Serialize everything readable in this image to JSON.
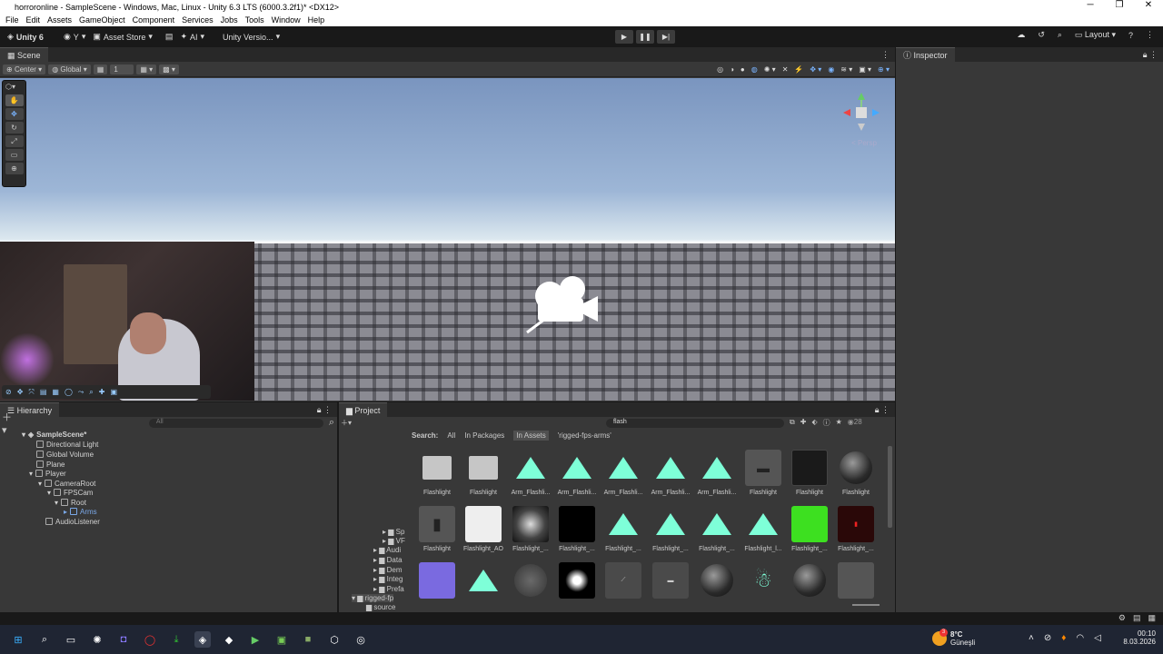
{
  "window": {
    "title": "horroronline - SampleScene - Windows, Mac, Linux - Unity 6.3 LTS (6000.3.2f1)* <DX12>",
    "minimize": "─",
    "maximize": "❐",
    "close": "✕"
  },
  "menu": [
    "File",
    "Edit",
    "Assets",
    "GameObject",
    "Component",
    "Services",
    "Jobs",
    "Tools",
    "Window",
    "Help"
  ],
  "toolbar": {
    "unity_label": "Unity 6",
    "account": "Y",
    "asset_store": "Asset Store",
    "ai": "AI",
    "version": "Unity Versio...",
    "layout": "Layout"
  },
  "scene": {
    "tab": "Scene",
    "center": "Center",
    "global": "Global",
    "snap": "1",
    "persp": "< Persp"
  },
  "inspector": {
    "tab": "Inspector"
  },
  "hierarchy": {
    "tab": "Hierarchy",
    "search_placeholder": "All",
    "items": [
      {
        "label": "SampleScene*"
      },
      {
        "label": "Directional Light"
      },
      {
        "label": "Global Volume"
      },
      {
        "label": "Plane"
      },
      {
        "label": "Player"
      },
      {
        "label": "CameraRoot"
      },
      {
        "label": "FPSCam"
      },
      {
        "label": "Root"
      },
      {
        "label": "Arms"
      },
      {
        "label": "AudioListener"
      }
    ]
  },
  "project": {
    "tab": "Project",
    "search_value": "flash",
    "count": "28",
    "search_label": "Search:",
    "filters": [
      "All",
      "In Packages",
      "In Assets",
      "'rigged-fps-arms'"
    ],
    "tree": [
      "Sp",
      "VF",
      "Audi",
      "Data",
      "Dem",
      "Integ",
      "Prefa",
      "rigged-fp",
      "source"
    ],
    "assets_row1": [
      "Flashlight",
      "Flashlight",
      "Arm_Flashli...",
      "Arm_Flashli...",
      "Arm_Flashli...",
      "Arm_Flashli...",
      "Arm_Flashli...",
      "Flashlight",
      "Flashlight",
      "Flashlight"
    ],
    "assets_row2": [
      "Flashlight",
      "Flashlight_AO",
      "Flashlight_...",
      "Flashlight_...",
      "Flashlight_...",
      "Flashlight_...",
      "Flashlight_...",
      "Flashlight_l...",
      "Flashlight_...",
      "Flashlight_..."
    ]
  },
  "taskbar": {
    "temp": "8°C",
    "weather": "Güneşli",
    "time": "00:10",
    "date": "8.03.2026",
    "badge": "3"
  }
}
